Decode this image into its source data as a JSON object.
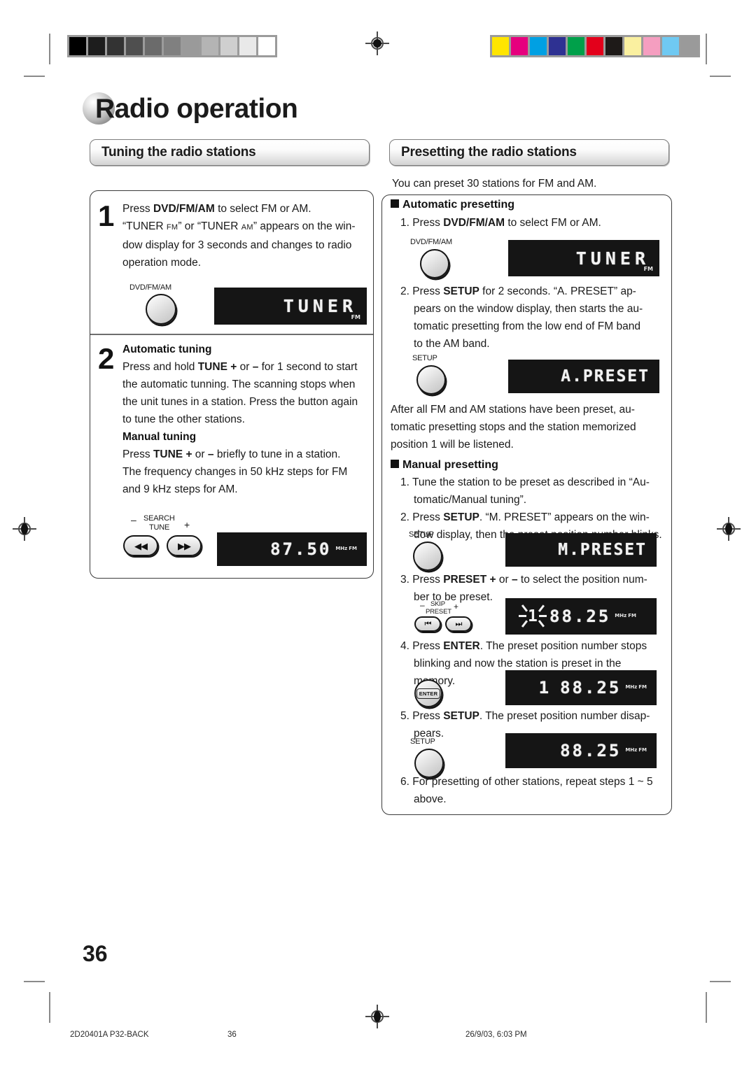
{
  "page": {
    "title": "Radio operation",
    "number": "36"
  },
  "calibration": {
    "gray_steps": [
      "#000000",
      "#1d1d1d",
      "#333333",
      "#4f4f4f",
      "#6b6b6b",
      "#808080",
      "#9a9a9a",
      "#b4b4b4",
      "#cfcfcf",
      "#e9e9e9",
      "#ffffff"
    ],
    "color_steps": [
      "#ffe500",
      "#e6007e",
      "#00a0e3",
      "#2e3192",
      "#00a04a",
      "#e3001b",
      "#1e1a18",
      "#faf0a0",
      "#f59ec0",
      "#6fc9f2",
      "#9a9a9a"
    ]
  },
  "left_column": {
    "section_title": "Tuning the radio stations",
    "step1": {
      "number": "1",
      "line1_a": "Press ",
      "line1_b": "DVD/FM/AM",
      "line1_c": " to select FM or AM.",
      "line2_a": "“TUNER ",
      "line2_fm": "FM",
      "line2_b": "” or “TUNER ",
      "line2_am": "AM",
      "line2_c": "” appears on the win-",
      "line3": "dow display for 3 seconds and changes to radio",
      "line4": "operation mode.",
      "button_label": "DVD/FM/AM",
      "display_text": "TUNER",
      "display_band": "FM"
    },
    "step2": {
      "number": "2",
      "auto_heading": "Automatic tuning",
      "auto_line1_a": "Press and hold ",
      "auto_line1_b": "TUNE +",
      "auto_line1_c": " or ",
      "auto_line1_d": "–",
      "auto_line1_e": " for 1 second to start",
      "auto_line2": "the automatic tunning. The scanning stops when",
      "auto_line3": "the unit tunes in a station. Press the button again",
      "auto_line4": "to tune the other stations.",
      "manual_heading": "Manual tuning",
      "manual_line1_a": "Press ",
      "manual_line1_b": "TUNE +",
      "manual_line1_c": " or ",
      "manual_line1_d": "–",
      "manual_line1_e": " briefly to tune in a station.",
      "manual_line2": "The frequency changes in 50 kHz steps for FM",
      "manual_line3": "and 9 kHz steps for AM.",
      "control": {
        "minus": "–",
        "plus": "+",
        "label_top": "SEARCH",
        "label_bottom": "TUNE",
        "btn_prev_glyph": "◀◀",
        "btn_next_glyph": "▶▶"
      },
      "display_value": "87.50",
      "display_unit": "MHz",
      "display_band": "FM"
    }
  },
  "right_column": {
    "section_title": "Presetting the radio stations",
    "intro": "You can preset 30 stations for FM and AM.",
    "auto_preset": {
      "heading": "Automatic presetting",
      "step1_num": "1.",
      "step1_a": "Press ",
      "step1_b": "DVD/FM/AM",
      "step1_c": " to select FM or AM.",
      "step1_button_label": "DVD/FM/AM",
      "step1_display": "TUNER",
      "step1_band": "FM",
      "step2_num": "2.",
      "step2_l1_a": "Press ",
      "step2_l1_b": "SETUP",
      "step2_l1_c": " for 2 seconds. “A. PRESET” ap-",
      "step2_l2": "pears on the window display, then starts the au-",
      "step2_l3": "tomatic presetting from the low end of FM band",
      "step2_l4": "to the AM band.",
      "step2_button_label": "SETUP",
      "step2_display": "A.PRESET",
      "after_l1": "After all FM and AM stations have been preset, au-",
      "after_l2": "tomatic presetting stops and the station memorized",
      "after_l3": "position 1 will be listened."
    },
    "manual_preset": {
      "heading": "Manual presetting",
      "step1_num": "1.",
      "step1_l1": "Tune the station to be preset as described in “Au-",
      "step1_l2": "tomatic/Manual tuning”.",
      "step2_num": "2.",
      "step2_l1_a": "Press ",
      "step2_l1_b": "SETUP",
      "step2_l1_c": ". “M. PRESET” appears on the win-",
      "step2_l2": "dow display, then the preset position number blinks.",
      "step2_button_label": "SETUP",
      "step2_display": "M.PRESET",
      "step3_num": "3.",
      "step3_l1_a": "Press ",
      "step3_l1_b": "PRESET +",
      "step3_l1_c": " or ",
      "step3_l1_d": "–",
      "step3_l1_e": " to select the position num-",
      "step3_l2": "ber to be preset.",
      "step3_control": {
        "minus": "–",
        "plus": "+",
        "label_top": "SKIP",
        "label_bottom": "PRESET",
        "btn_prev_glyph": "⏮",
        "btn_next_glyph": "⏭"
      },
      "step3_blink_number": "1",
      "step3_display": "88.25",
      "step3_unit": "MHz",
      "step3_band": "FM",
      "step4_num": "4.",
      "step4_l1_a": "Press ",
      "step4_l1_b": "ENTER",
      "step4_l1_c": ". The preset position number stops",
      "step4_l2": "blinking and now the station is preset in the",
      "step4_l3": "memory.",
      "step4_button_label": "ENTER",
      "step4_preset_num": "1",
      "step4_display": "88.25",
      "step4_unit": "MHz",
      "step4_band": "FM",
      "step5_num": "5.",
      "step5_l1_a": "Press ",
      "step5_l1_b": "SETUP",
      "step5_l1_c": ". The preset position number disap-",
      "step5_l2": "pears.",
      "step5_button_label": "SETUP",
      "step5_display": "88.25",
      "step5_unit": "MHz",
      "step5_band": "FM",
      "step6_num": "6.",
      "step6_l1": "For presetting of other stations, repeat steps 1 ~ 5",
      "step6_l2": "above."
    }
  },
  "footer": {
    "doc_code": "2D20401A P32-BACK",
    "page": "36",
    "timestamp": "26/9/03, 6:03 PM"
  }
}
